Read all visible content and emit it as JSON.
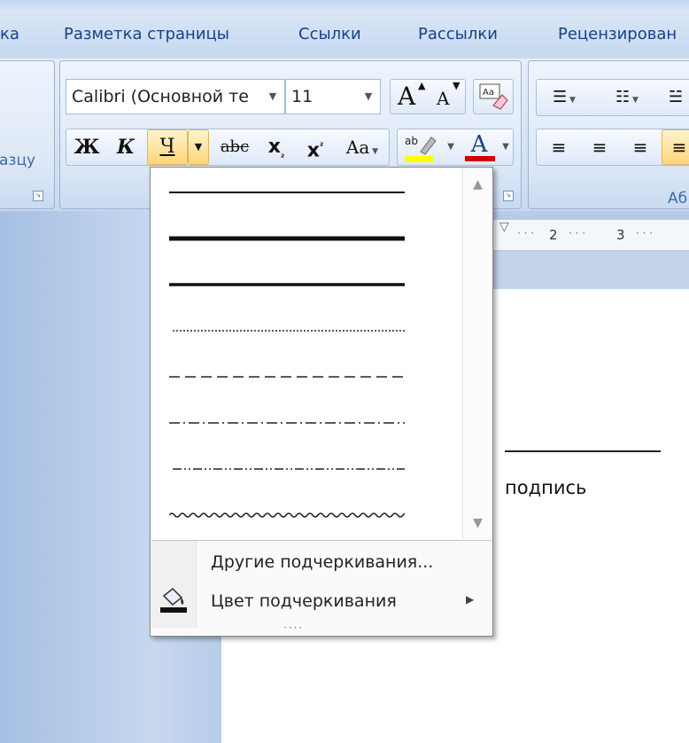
{
  "tabs": [
    "ка",
    "Разметка страницы",
    "Ссылки",
    "Рассылки",
    "Рецензирован"
  ],
  "clipboard_group": {
    "label": "азцу"
  },
  "font_group": {
    "font_name": "Calibri (Основной те",
    "font_size": "11",
    "buttons": {
      "bold": "Ж",
      "italic": "К",
      "underline": "Ч",
      "strikethrough": "abc",
      "subscript": "x",
      "superscript": "x",
      "change_case": "Aa",
      "grow_font": "A",
      "shrink_font": "A",
      "font_color": "A"
    }
  },
  "styles_group": {
    "label": "Аб"
  },
  "ruler": {
    "marks": [
      "2",
      "3"
    ]
  },
  "document": {
    "signature_caption": "подпись"
  },
  "underline_menu": {
    "styles": [
      "single",
      "thick",
      "double-weight",
      "dotted",
      "dashed",
      "dash-dot",
      "dash-dot-dot",
      "wave"
    ],
    "more_underlines": "Другие подчеркивания...",
    "underline_color": "Цвет подчеркивания",
    "grip": "····"
  },
  "colors": {
    "highlight": "#ffff00",
    "font_color": "#d00000",
    "accent_text": "#15428b"
  }
}
